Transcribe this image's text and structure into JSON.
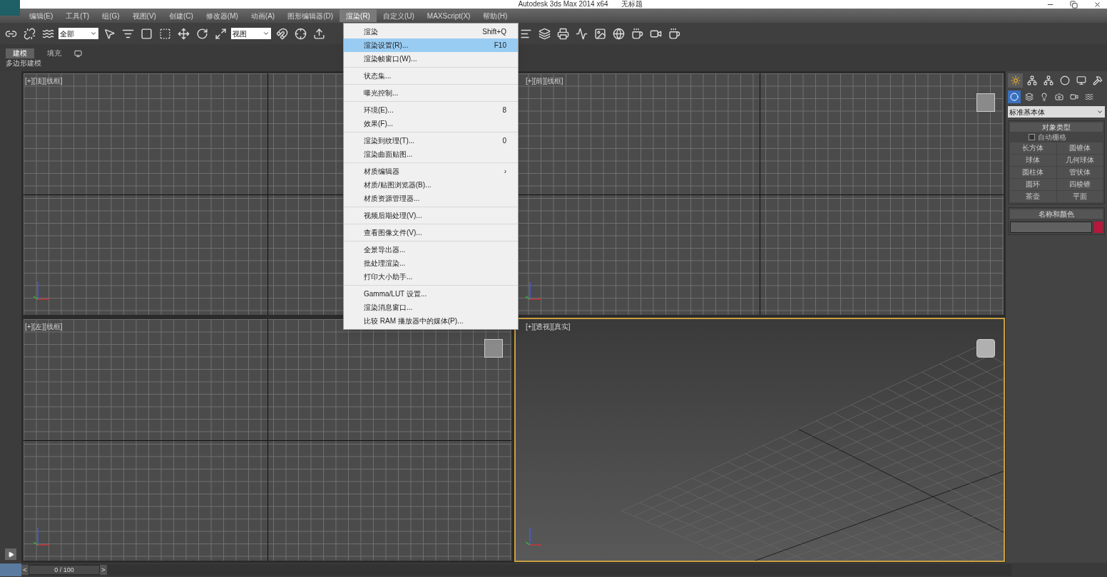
{
  "window": {
    "title": "Autodesk 3ds Max  2014 x64",
    "document": "无标题"
  },
  "menu_bar": [
    {
      "label": "编辑(E)",
      "selected": false
    },
    {
      "label": "工具(T)",
      "selected": false
    },
    {
      "label": "组(G)",
      "selected": false
    },
    {
      "label": "视图(V)",
      "selected": false
    },
    {
      "label": "创建(C)",
      "selected": false
    },
    {
      "label": "修改器(M)",
      "selected": false
    },
    {
      "label": "动画(A)",
      "selected": false
    },
    {
      "label": "图形编辑器(D)",
      "selected": false
    },
    {
      "label": "渲染(R)",
      "selected": true
    },
    {
      "label": "自定义(U)",
      "selected": false
    },
    {
      "label": "MAXScript(X)",
      "selected": false
    },
    {
      "label": "帮助(H)",
      "selected": false
    }
  ],
  "toolbar": {
    "selection_filter": "全部",
    "reference_coord": "视图"
  },
  "ribbon": {
    "tabs": [
      {
        "label": "建模",
        "selected": true
      },
      {
        "label": "填充",
        "selected": false
      }
    ],
    "subtitle": "多边形建模"
  },
  "viewports": [
    {
      "label": "[+][顶][线框]",
      "kind": "ortho",
      "selected": false
    },
    {
      "label": "[+][前][线框]",
      "kind": "ortho",
      "selected": false
    },
    {
      "label": "[+][左][线框]",
      "kind": "ortho",
      "selected": false
    },
    {
      "label": "[+][透视][真实]",
      "kind": "perspective",
      "selected": true
    }
  ],
  "render_menu": [
    [
      {
        "label": "渲染",
        "shortcut": "Shift+Q",
        "selected": false
      },
      {
        "label": "渲染设置(R)...",
        "shortcut": "F10",
        "selected": true
      },
      {
        "label": "渲染帧窗口(W)...",
        "selected": false
      }
    ],
    [
      {
        "label": "状态集...",
        "selected": false
      }
    ],
    [
      {
        "label": "曝光控制...",
        "selected": false
      }
    ],
    [
      {
        "label": "环境(E)...",
        "shortcut": "8",
        "selected": false
      },
      {
        "label": "效果(F)...",
        "selected": false
      }
    ],
    [
      {
        "label": "渲染到纹理(T)...",
        "shortcut": "0",
        "selected": false
      },
      {
        "label": "渲染曲面贴图...",
        "selected": false
      }
    ],
    [
      {
        "label": "材质编辑器",
        "shortcut": "›",
        "selected": false
      },
      {
        "label": "材质/贴图浏览器(B)...",
        "selected": false
      },
      {
        "label": "材质资源管理器...",
        "selected": false
      }
    ],
    [
      {
        "label": "视频后期处理(V)...",
        "selected": false
      }
    ],
    [
      {
        "label": "查看图像文件(V)...",
        "selected": false
      }
    ],
    [
      {
        "label": "全景导出器...",
        "selected": false
      },
      {
        "label": "批处理渲染...",
        "selected": false
      },
      {
        "label": "打印大小助手...",
        "selected": false
      }
    ],
    [
      {
        "label": "Gamma/LUT 设置...",
        "selected": false
      },
      {
        "label": "渲染消息窗口...",
        "selected": false
      },
      {
        "label": "比较 RAM 播放器中的媒体(P)...",
        "selected": false
      }
    ]
  ],
  "command_panel": {
    "category": "标准基本体",
    "object_type": {
      "title": "对象类型",
      "autogrid": {
        "label": "自动栅格",
        "checked": false
      },
      "buttons": [
        "长方体",
        "圆锥体",
        "球体",
        "几何球体",
        "圆柱体",
        "管状体",
        "圆环",
        "四棱锥",
        "茶壶",
        "平面"
      ]
    },
    "name_color": {
      "title": "名称和颜色",
      "color": "#b8163a"
    }
  },
  "time_slider": {
    "prev": "<",
    "position": "0 / 100",
    "next": ">"
  }
}
